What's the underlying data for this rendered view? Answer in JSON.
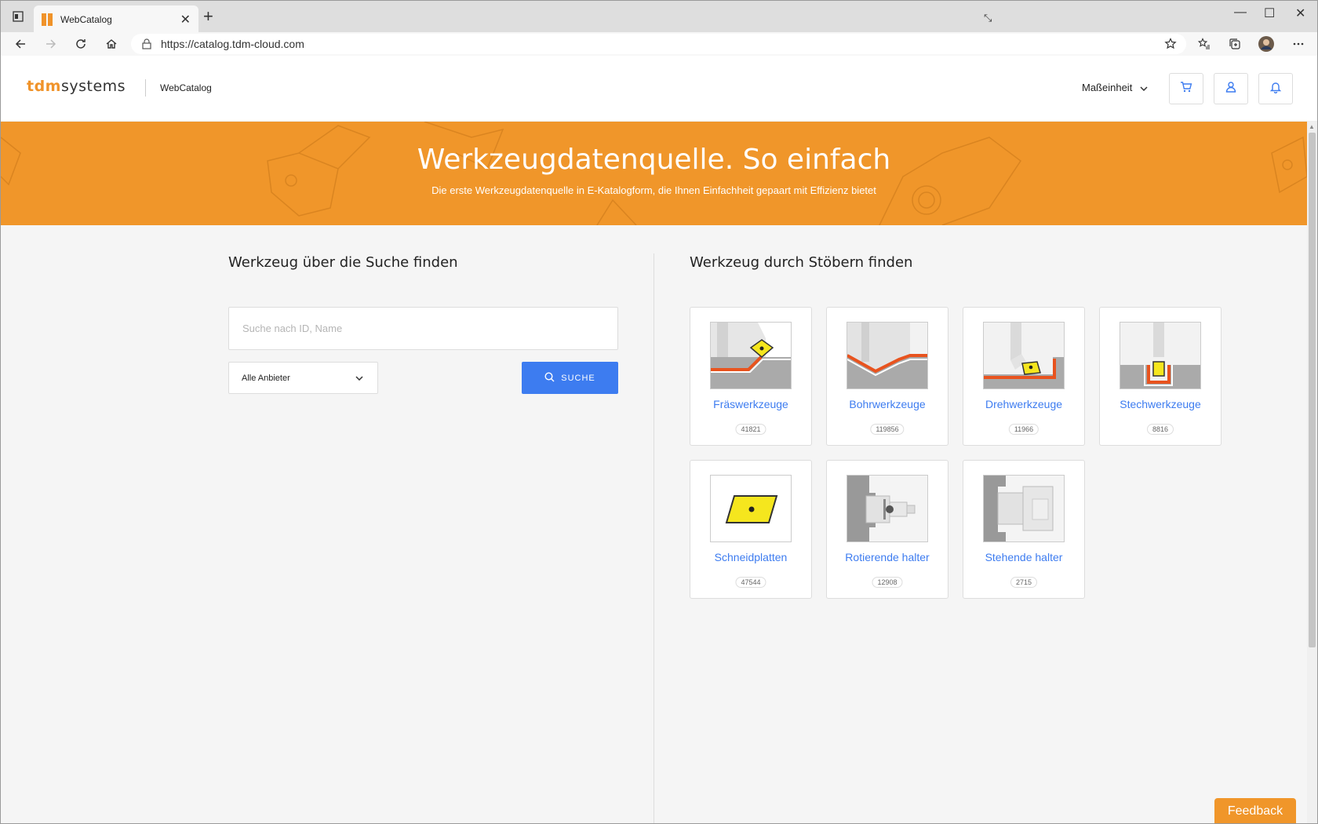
{
  "browser": {
    "tab_title": "WebCatalog",
    "url": "https://catalog.tdm-cloud.com"
  },
  "header": {
    "logo_tdm": "tdm",
    "logo_systems": "systems",
    "brand": "WebCatalog",
    "unit_label": "Maßeinheit"
  },
  "hero": {
    "title": "Werkzeugdatenquelle. So einfach",
    "subtitle": "Die erste Werkzeugdatenquelle in E-Katalogform, die Ihnen Einfachheit gepaart mit Effizienz bietet"
  },
  "search": {
    "title": "Werkzeug über die Suche finden",
    "placeholder": "Suche nach ID, Name",
    "vendor_selected": "Alle Anbieter",
    "button_label": "SUCHE"
  },
  "browse": {
    "title": "Werkzeug durch Stöbern finden",
    "categories": [
      {
        "label": "Fräswerkzeuge",
        "count": "41821",
        "icon": "milling-tool-icon"
      },
      {
        "label": "Bohrwerkzeuge",
        "count": "119856",
        "icon": "drilling-tool-icon"
      },
      {
        "label": "Drehwerkzeuge",
        "count": "11966",
        "icon": "turning-tool-icon"
      },
      {
        "label": "Stechwerkzeuge",
        "count": "8816",
        "icon": "grooving-tool-icon"
      },
      {
        "label": "Schneidplatten",
        "count": "47544",
        "icon": "cutting-insert-icon"
      },
      {
        "label": "Rotierende halter",
        "count": "12908",
        "icon": "rotating-holder-icon"
      },
      {
        "label": "Stehende halter",
        "count": "2715",
        "icon": "stationary-holder-icon"
      }
    ]
  },
  "feedback_label": "Feedback",
  "colors": {
    "accent_orange": "#f0962a",
    "link_blue": "#3d7cf0",
    "insert_yellow": "#f5e61e",
    "cut_red": "#e8531e"
  }
}
